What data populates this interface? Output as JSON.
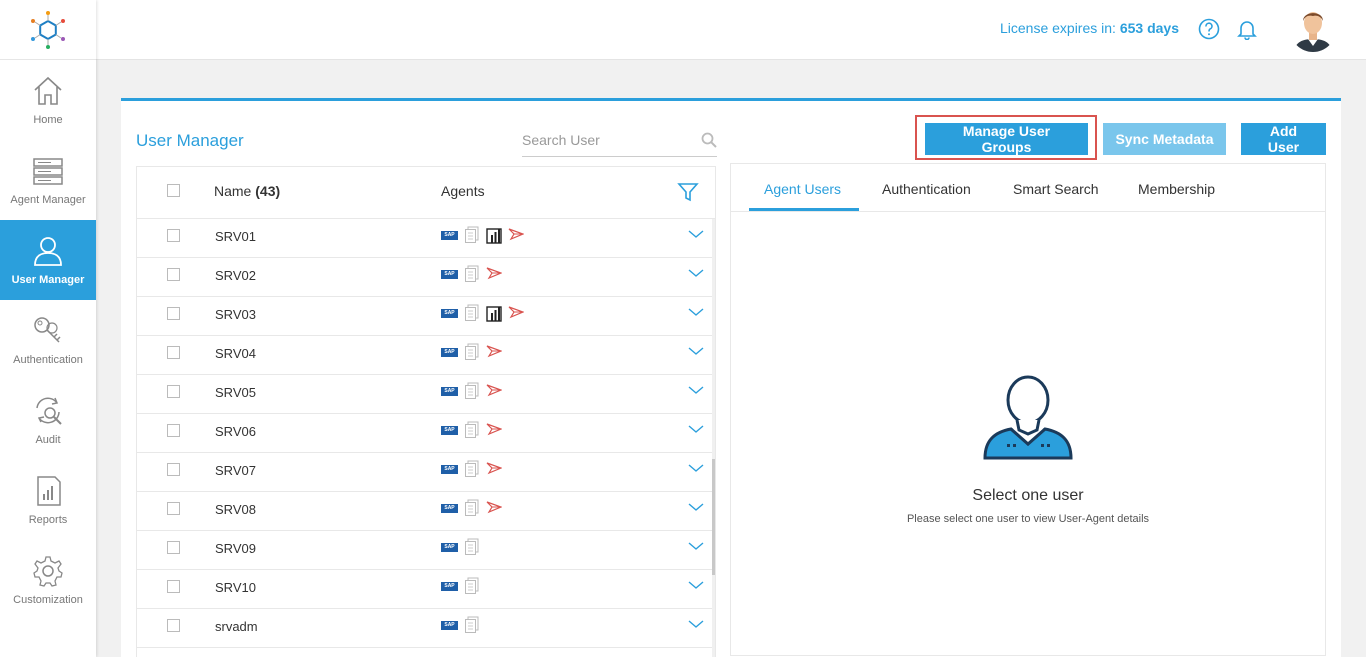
{
  "sidebar": {
    "items": [
      {
        "label": "Home",
        "icon": "home-icon"
      },
      {
        "label": "Agent Manager",
        "icon": "server-icon"
      },
      {
        "label": "User Manager",
        "icon": "user-icon"
      },
      {
        "label": "Authentication",
        "icon": "key-icon"
      },
      {
        "label": "Audit",
        "icon": "refresh-search-icon"
      },
      {
        "label": "Reports",
        "icon": "report-icon"
      },
      {
        "label": "Customization",
        "icon": "gear-icon"
      }
    ],
    "active": "User Manager"
  },
  "topbar": {
    "license_label": "License expires in:",
    "license_days": "653 days"
  },
  "main": {
    "title": "User Manager",
    "search_placeholder": "Search User",
    "buttons": {
      "manage_groups": "Manage User Groups",
      "sync_metadata": "Sync Metadata",
      "add_user": "Add User"
    },
    "table": {
      "col_name": "Name",
      "count": "(43)",
      "col_agents": "Agents",
      "rows": [
        {
          "name": "SRV01",
          "agents": [
            "sap",
            "doc",
            "powerbi",
            "arrow"
          ]
        },
        {
          "name": "SRV02",
          "agents": [
            "sap",
            "doc",
            "arrow"
          ]
        },
        {
          "name": "SRV03",
          "agents": [
            "sap",
            "doc",
            "powerbi",
            "arrow"
          ]
        },
        {
          "name": "SRV04",
          "agents": [
            "sap",
            "doc",
            "arrow"
          ]
        },
        {
          "name": "SRV05",
          "agents": [
            "sap",
            "doc",
            "arrow"
          ]
        },
        {
          "name": "SRV06",
          "agents": [
            "sap",
            "doc",
            "arrow"
          ]
        },
        {
          "name": "SRV07",
          "agents": [
            "sap",
            "doc",
            "arrow"
          ]
        },
        {
          "name": "SRV08",
          "agents": [
            "sap",
            "doc",
            "arrow"
          ]
        },
        {
          "name": "SRV09",
          "agents": [
            "sap",
            "doc"
          ]
        },
        {
          "name": "SRV10",
          "agents": [
            "sap",
            "doc"
          ]
        },
        {
          "name": "srvadm",
          "agents": [
            "sap",
            "doc"
          ]
        }
      ]
    },
    "tabs": [
      "Agent Users",
      "Authentication",
      "Smart Search",
      "Membership"
    ],
    "active_tab": "Agent Users",
    "empty_title": "Select one user",
    "empty_subtitle": "Please select one user to view User-Agent details"
  },
  "colors": {
    "accent": "#2b9fdc",
    "accent_light": "#7ac6ec",
    "highlight": "#d9534f",
    "sap_blue": "#1f5fa8",
    "arrow_red": "#d9534f"
  }
}
